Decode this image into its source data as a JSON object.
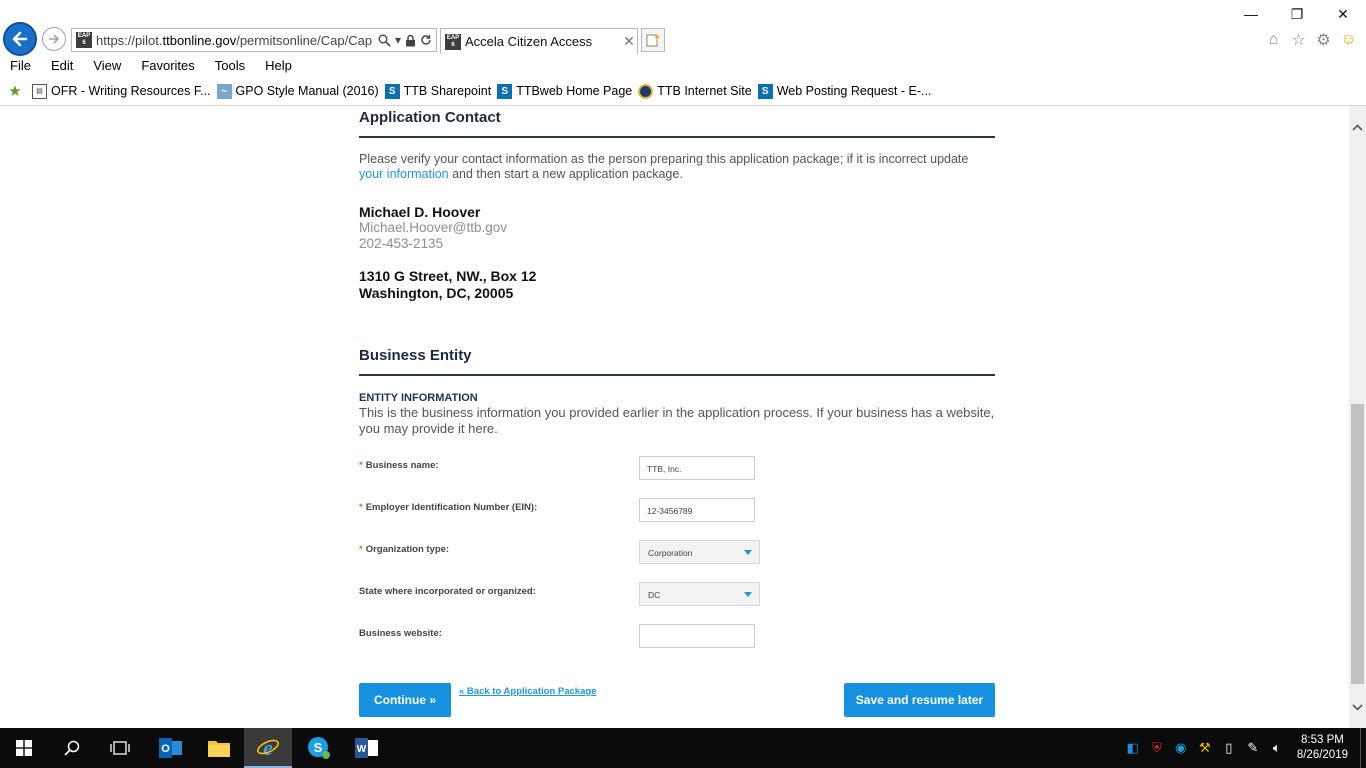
{
  "browser": {
    "url_prefix": "https://pilot.",
    "url_domain": "ttbonline.gov",
    "url_rest": "/permitsonline/Cap/Cap",
    "tab_title": "Accela Citizen Access",
    "eap_label": "EAP 6",
    "menu": [
      "File",
      "Edit",
      "View",
      "Favorites",
      "Tools",
      "Help"
    ],
    "favorites": [
      {
        "label": "OFR - Writing Resources F...",
        "icon": "document-icon"
      },
      {
        "label": "GPO Style Manual (2016)",
        "icon": "map-icon"
      },
      {
        "label": "TTB Sharepoint",
        "icon": "sharepoint-icon"
      },
      {
        "label": "TTBweb Home Page",
        "icon": "sharepoint-icon"
      },
      {
        "label": "TTB Internet Site",
        "icon": "ttb-seal-icon"
      },
      {
        "label": "Web Posting Request - E-...",
        "icon": "sharepoint-icon"
      }
    ]
  },
  "contact": {
    "section_title": "Application Contact",
    "intro_before": "Please verify your contact information as the person preparing this application package; if it is incorrect update ",
    "intro_link": "your information",
    "intro_after": " and then start a new application package.",
    "name": "Michael D. Hoover",
    "email": "Michael.Hoover@ttb.gov",
    "phone": "202-453-2135",
    "address_line1": "1310 G Street, NW., Box 12",
    "address_line2": "Washington, DC, 20005"
  },
  "business": {
    "section_title": "Business Entity",
    "sub_title": "ENTITY INFORMATION",
    "description": "This is the business information you provided earlier in the application process. If your business has a website, you may provide it here.",
    "fields": {
      "business_name": {
        "label": "Business name:",
        "value": "TTB, Inc.",
        "required": true
      },
      "ein": {
        "label": "Employer Identification Number (EIN):",
        "value": "12-3456789",
        "required": true
      },
      "org_type": {
        "label": "Organization type:",
        "value": "Corporation",
        "required": true
      },
      "state": {
        "label": "State where incorporated or organized:",
        "value": "DC",
        "required": false
      },
      "website": {
        "label": "Business website:",
        "value": "",
        "required": false
      }
    },
    "required_mark": "*"
  },
  "actions": {
    "continue_label": "Continue »",
    "back_label": "« Back to Application Package",
    "save_label": "Save and resume later"
  },
  "taskbar": {
    "time": "8:53 PM",
    "date": "8/26/2019"
  },
  "colors": {
    "accent": "#1691e0",
    "link": "#1a9ad6",
    "required": "#e66f1e",
    "heading": "#1f2a3c"
  }
}
